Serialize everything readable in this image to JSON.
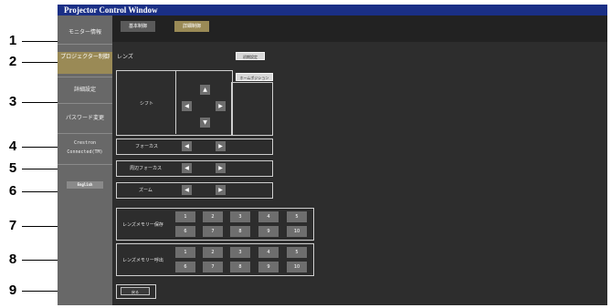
{
  "window": {
    "title": "Projector Control Window"
  },
  "tabs": [
    "基本制御",
    "詳細制御"
  ],
  "sidebar": {
    "items": [
      {
        "label": "モニター情報",
        "active": false
      },
      {
        "label": "プロジェクター制御",
        "active": true
      },
      {
        "label": "詳細設定",
        "active": false
      },
      {
        "label": "パスワード変更",
        "active": false
      },
      {
        "label": "Crestron Connected(TM)",
        "active": false
      }
    ],
    "english_label": "English"
  },
  "main": {
    "section_title": "レンズ",
    "initial_setting_button": "初期設定",
    "home_position_button": "ホームポジション",
    "shift_label": "シフト",
    "focus_label": "フォーカス",
    "peripheral_focus_label": "周辺フォーカス",
    "zoom_label": "ズーム",
    "memory_save_label": "レンズメモリー保存",
    "memory_load_label": "レンズメモリー呼出",
    "memory_keys_row1": [
      "1",
      "2",
      "3",
      "4",
      "5"
    ],
    "memory_keys_row2": [
      "6",
      "7",
      "8",
      "9",
      "10"
    ],
    "back_button": "戻る"
  },
  "arrows": {
    "left": "◀",
    "right": "▶",
    "up": "▲",
    "down": "▼"
  },
  "callouts": [
    "1",
    "2",
    "3",
    "4",
    "5",
    "6",
    "7",
    "8",
    "9"
  ],
  "colors": {
    "title_bar": "#1a2f86",
    "active_tab": "#9a8a56",
    "sidebar": "#686868"
  }
}
